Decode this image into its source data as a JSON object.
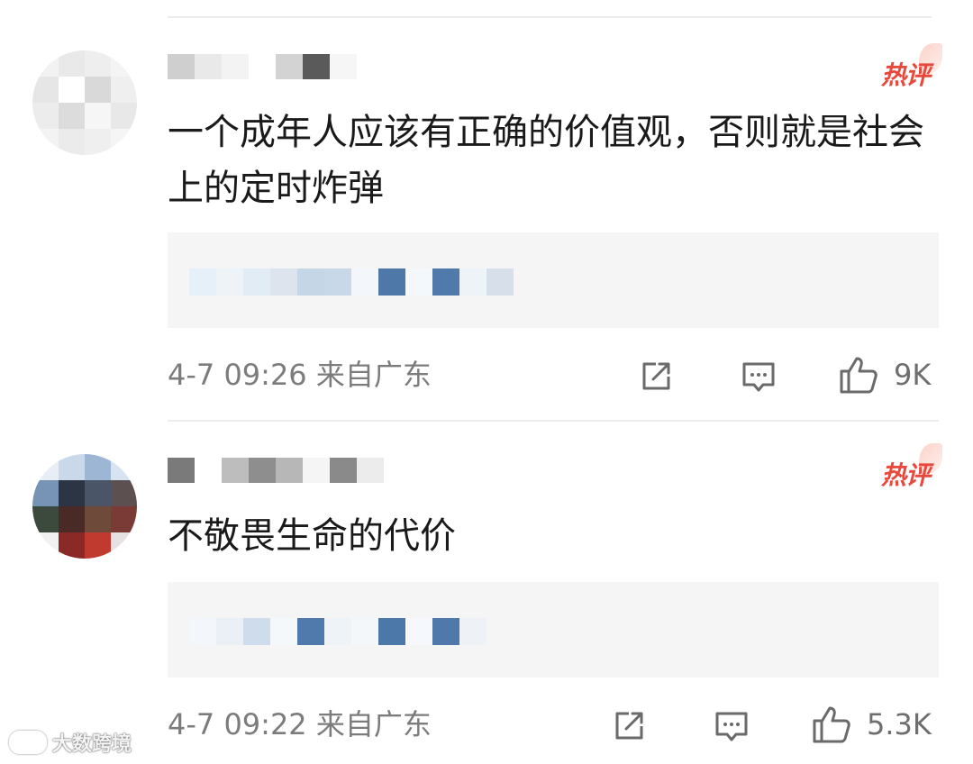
{
  "comments": [
    {
      "badge": "热评",
      "text": "一个成年人应该有正确的价值观，否则就是社会上的定时炸弹",
      "date": "4-7 09:26",
      "location": "来自广东",
      "likes": "9K",
      "avatar_colors": [
        "#f2f2f2",
        "#e9e9e9",
        "#eeeeee",
        "#f4f4f4",
        "#e6e6e6",
        "#ffffff",
        "#d9d9d9",
        "#efefef",
        "#ececec",
        "#dcdcdc",
        "#f6f6f6",
        "#e8e8e8",
        "#f3f3f3",
        "#ebebeb",
        "#efefef",
        "#f5f5f5"
      ],
      "username_colors": [
        "#cfcfcf",
        "#e9e9e9",
        "#f3f3f3",
        "#ffffff",
        "#d3d3d3",
        "#5a5a5a",
        "#f6f6f6"
      ],
      "quote_colors": [
        "#e6f0f8",
        "#eef3f8",
        "#e2ecf5",
        "#dde4ee",
        "#c5d6e6",
        "#c9d8e6",
        "#f3f6fa",
        "#4d78a8",
        "#f5f8fb",
        "#4f7aab",
        "#eef3f8",
        "#d6dfea"
      ]
    },
    {
      "badge": "热评",
      "text": "不敬畏生命的代价",
      "date": "4-7 09:22",
      "location": "来自广东",
      "likes": "5.3K",
      "avatar_colors": [
        "#e7eef6",
        "#c9d9ea",
        "#9cb6d4",
        "#d7e3f0",
        "#7793b5",
        "#2c3544",
        "#4a5568",
        "#5c5050",
        "#3b4a3c",
        "#4a2a26",
        "#6e4a3a",
        "#7a3a36",
        "#f1f1f1",
        "#8a2a26",
        "#c03a30",
        "#e7e2e2"
      ],
      "username_colors": [
        "#7a7a7a",
        "#ffffff",
        "#bdbdbd",
        "#8e8e8e",
        "#b7b7b7",
        "#f5f5f5",
        "#8a8a8a",
        "#ececec"
      ],
      "quote_colors": [
        "#f3f6fa",
        "#eaf0f6",
        "#cfdceb",
        "#f5f8fb",
        "#4f7aab",
        "#eef3f8",
        "#f4f7fa",
        "#4b77a9",
        "#f6f8fb",
        "#4e79aa",
        "#eef2f7"
      ]
    }
  ],
  "watermark": "大数跨境",
  "icons": {
    "share": "share-icon",
    "reply": "comment-icon",
    "like": "thumbs-up-icon"
  }
}
